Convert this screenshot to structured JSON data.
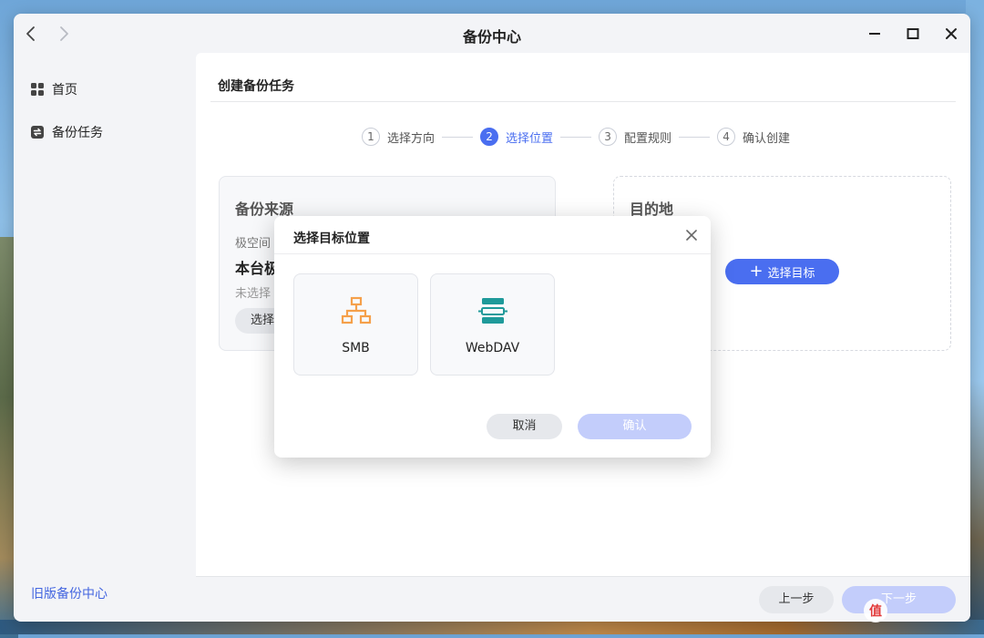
{
  "window": {
    "title": "备份中心"
  },
  "sidebar": {
    "items": [
      {
        "label": "首页",
        "icon": "grid-icon"
      },
      {
        "label": "备份任务",
        "icon": "backup-icon"
      }
    ],
    "legacy_link": "旧版备份中心"
  },
  "content": {
    "header": "创建备份任务",
    "steps": [
      {
        "num": "1",
        "label": "选择方向",
        "active": false
      },
      {
        "num": "2",
        "label": "选择位置",
        "active": true
      },
      {
        "num": "3",
        "label": "配置规则",
        "active": false
      },
      {
        "num": "4",
        "label": "确认创建",
        "active": false
      }
    ],
    "source": {
      "title": "备份来源",
      "sub": "极空间",
      "device": "本台极",
      "empty": "未选择",
      "button": "选择"
    },
    "destination": {
      "title": "目的地",
      "button": "选择目标"
    }
  },
  "footer": {
    "prev": "上一步",
    "next": "下一步"
  },
  "modal": {
    "title": "选择目标位置",
    "options": [
      {
        "label": "SMB",
        "icon": "network-icon",
        "color": "#f5a04a"
      },
      {
        "label": "WebDAV",
        "icon": "server-icon",
        "color": "#1f9a9a"
      }
    ],
    "cancel": "取消",
    "confirm": "确认"
  },
  "colors": {
    "accent": "#4a6ef0",
    "accent_disabled": "#c3cdfb"
  },
  "watermark": {
    "text": "值",
    "icon": "logo-icon"
  }
}
